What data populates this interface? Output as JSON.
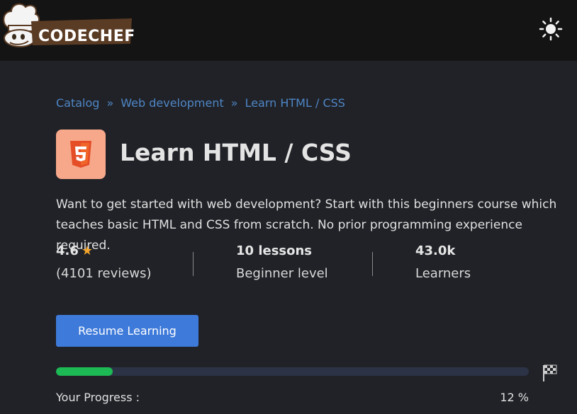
{
  "header": {
    "logo_text": "CODECHEF",
    "theme_toggle_icon": "sun-icon"
  },
  "breadcrumb": {
    "items": [
      "Catalog",
      "Web development",
      "Learn HTML / CSS"
    ],
    "separator": "»"
  },
  "course": {
    "icon": "html5-icon",
    "icon_bg": "#f8a88a",
    "title": "Learn HTML / CSS",
    "description": "Want to get started with web development? Start with this beginners course which teaches basic HTML and CSS from scratch. No prior programming experience required."
  },
  "stats": {
    "rating": "4.6",
    "reviews": "(4101 reviews)",
    "lessons": "10 lessons",
    "level": "Beginner level",
    "learners_count": "43.0k",
    "learners_label": "Learners"
  },
  "actions": {
    "resume_label": "Resume Learning"
  },
  "progress": {
    "label": "Your Progress :",
    "percent_text": "12 %",
    "value": 0.12,
    "end_icon": "finish-flag-icon"
  },
  "colors": {
    "accent": "#3e7ad9",
    "link": "#4f86c6",
    "progress_fill": "#1db954",
    "star": "#f4a52c"
  }
}
